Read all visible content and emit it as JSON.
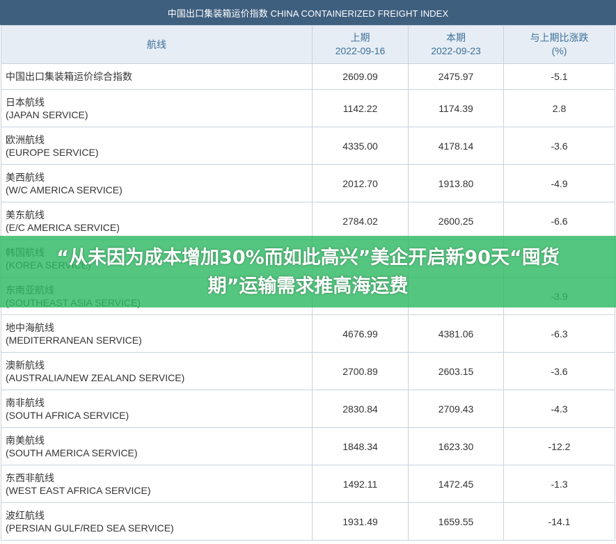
{
  "table": {
    "title": "中国出口集装箱运价指数 CHINA CONTAINERIZED FREIGHT INDEX",
    "headers": {
      "route": "航线",
      "prev_label": "上期",
      "prev_date": "2022-09-16",
      "curr_label": "本期",
      "curr_date": "2022-09-23",
      "change_label": "与上期比涨跌",
      "change_unit": "(%)"
    },
    "rows": [
      {
        "cn": "中国出口集装箱运价综合指数",
        "en": "",
        "prev": "2609.09",
        "curr": "2475.97",
        "change": "-5.1"
      },
      {
        "cn": "日本航线",
        "en": "(JAPAN SERVICE)",
        "prev": "1142.22",
        "curr": "1174.39",
        "change": "2.8"
      },
      {
        "cn": "欧洲航线",
        "en": "(EUROPE SERVICE)",
        "prev": "4335.00",
        "curr": "4178.14",
        "change": "-3.6"
      },
      {
        "cn": "美西航线",
        "en": "(W/C AMERICA SERVICE)",
        "prev": "2012.70",
        "curr": "1913.80",
        "change": "-4.9"
      },
      {
        "cn": "美东航线",
        "en": "(E/C AMERICA SERVICE)",
        "prev": "2784.02",
        "curr": "2600.25",
        "change": "-6.6"
      },
      {
        "cn": "韩国航线",
        "en": "(KOREA SERVICE)",
        "prev": "",
        "curr": "",
        "change": ""
      },
      {
        "cn": "东南亚航线",
        "en": "(SOUTHEAST ASIA SERVICE)",
        "prev": "",
        "curr": "",
        "change": "-3.9"
      },
      {
        "cn": "地中海航线",
        "en": "(MEDITERRANEAN SERVICE)",
        "prev": "4676.99",
        "curr": "4381.06",
        "change": "-6.3"
      },
      {
        "cn": "澳新航线",
        "en": "(AUSTRALIA/NEW ZEALAND SERVICE)",
        "prev": "2700.89",
        "curr": "2603.15",
        "change": "-3.6"
      },
      {
        "cn": "南非航线",
        "en": "(SOUTH AFRICA SERVICE)",
        "prev": "2830.84",
        "curr": "2709.43",
        "change": "-4.3"
      },
      {
        "cn": "南美航线",
        "en": "(SOUTH AMERICA SERVICE)",
        "prev": "1848.34",
        "curr": "1623.30",
        "change": "-12.2"
      },
      {
        "cn": "东西非航线",
        "en": "(WEST EAST AFRICA SERVICE)",
        "prev": "1492.11",
        "curr": "1472.45",
        "change": "-1.3"
      },
      {
        "cn": "波红航线",
        "en": "(PERSIAN GULF/RED SEA SERVICE)",
        "prev": "1931.49",
        "curr": "1659.55",
        "change": "-14.1"
      }
    ]
  },
  "banner": {
    "text": "“从未因为成本增加30%而如此高兴”美企开启新90天“囤货期”运输需求推高海运费"
  },
  "colors": {
    "title_bg": "#3f5f7f",
    "header_bg": "#e6edf4",
    "header_text": "#3d6f99",
    "banner_bg": "#2eb963"
  }
}
